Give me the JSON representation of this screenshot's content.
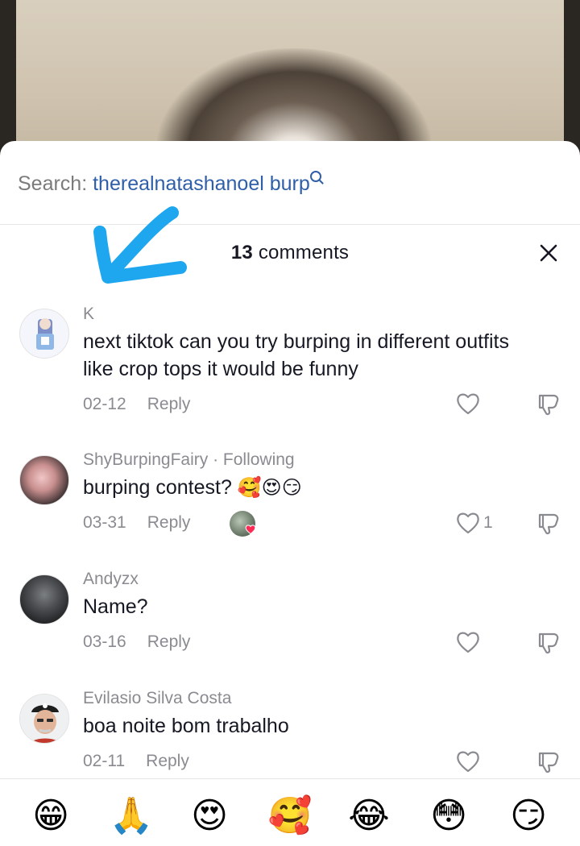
{
  "search": {
    "label": "Search: ",
    "term": "therealnatashanoel burp"
  },
  "header": {
    "count": "13",
    "label": " comments"
  },
  "comments": [
    {
      "username": "K",
      "text": "next tiktok can you try burping in different outfits like crop tops it would be funny",
      "date": "02-12",
      "reply": "Reply",
      "likes": ""
    },
    {
      "username": "ShyBurpingFairy",
      "following": " · Following",
      "text": "burping contest? ",
      "emojis": "🥰😍😏",
      "date": "03-31",
      "reply": "Reply",
      "likes": "1"
    },
    {
      "username": "Andyzx",
      "text": "Name?",
      "date": "03-16",
      "reply": "Reply",
      "likes": ""
    },
    {
      "username": "Evilasio Silva Costa",
      "text": "boa noite bom trabalho",
      "date": "02-11",
      "reply": "Reply",
      "likes": ""
    }
  ],
  "emoji_bar": [
    "😁",
    "🙏",
    "😍",
    "🥰",
    "😂",
    "😳",
    "😏"
  ],
  "colors": {
    "accent": "#2f5fa8",
    "annotation": "#1ea7ee",
    "muted": "#8a8b91",
    "text": "#161823"
  },
  "icons": [
    "search-icon",
    "close-icon",
    "heart-icon",
    "dislike-icon"
  ]
}
